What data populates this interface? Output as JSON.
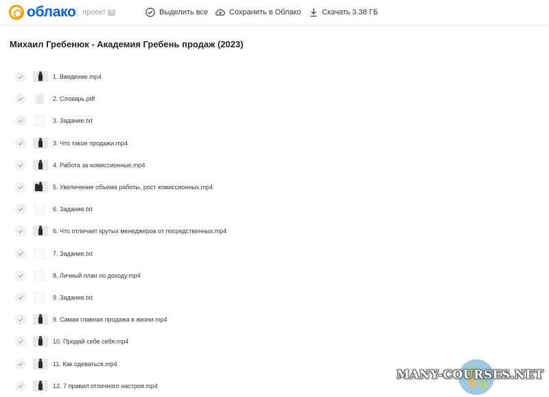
{
  "header": {
    "logo_text": "облако",
    "project_label": "проект",
    "project_badge": "M",
    "select_all": "Выделить все",
    "save_to_cloud": "Сохранить в Облако",
    "download": "Скачать 3.38 ГБ"
  },
  "folder": {
    "title": "Михаил Гребенюк - Академия Гребень продаж (2023)"
  },
  "files": [
    {
      "name": "1. Введение.mp4",
      "thumb": "video"
    },
    {
      "name": "2. Словарь.pdf",
      "thumb": "pdf"
    },
    {
      "name": "3. Задание.txt",
      "thumb": "txt"
    },
    {
      "name": "3. Что такое продажи.mp4",
      "thumb": "video"
    },
    {
      "name": "4. Работа за комиссионные.mp4",
      "thumb": "video"
    },
    {
      "name": "5. Увеличение объема работы, рост комиссионных.mp4",
      "thumb": "video2"
    },
    {
      "name": "6. Задание.txt",
      "thumb": "txt"
    },
    {
      "name": "6. Что отличает крутых менеджеров от посредственных.mp4",
      "thumb": "video"
    },
    {
      "name": "7. Задание.txt",
      "thumb": "txt"
    },
    {
      "name": "8. Личный план по доходу.mp4",
      "thumb": "txt"
    },
    {
      "name": "9. Задание.txt",
      "thumb": "txt"
    },
    {
      "name": "9. Самая главная продажа в жизни.mp4",
      "thumb": "video"
    },
    {
      "name": "10. Продай себе себя.mp4",
      "thumb": "video"
    },
    {
      "name": "11. Как одеваться.mp4",
      "thumb": "video"
    },
    {
      "name": "12. 7 правил отличного настроя.mp4",
      "thumb": "video"
    }
  ],
  "watermark": {
    "text": "MANY-COURSES.NET"
  },
  "colors": {
    "logo_blue": "#005ff9",
    "logo_orange": "#ff9e00",
    "check_bg": "#eef0f2"
  },
  "icons": {
    "select_all": "check-circle-icon",
    "save": "cloud-upload-icon",
    "download": "download-icon",
    "row_check": "check-icon"
  }
}
